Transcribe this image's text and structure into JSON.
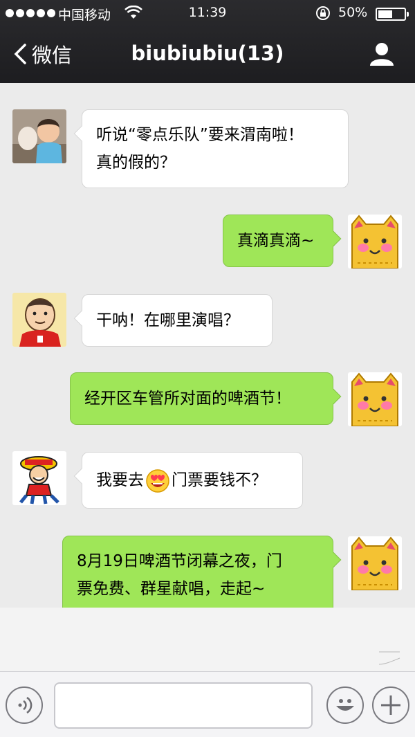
{
  "status_bar": {
    "carrier": "中国移动",
    "time": "11:39",
    "battery": "50%"
  },
  "nav": {
    "back_label": "微信",
    "title": "biubiubiu(13)"
  },
  "messages": [
    {
      "side": "in",
      "lines": [
        "听说“零点乐队”要来渭南啦！",
        "真的假的？"
      ]
    },
    {
      "side": "out",
      "lines": [
        "真滴真滴~"
      ]
    },
    {
      "side": "in",
      "lines": [
        "干呐！在哪里演唱？"
      ]
    },
    {
      "side": "out",
      "lines": [
        "经开区车管所对面的啤酒节！"
      ]
    },
    {
      "side": "in",
      "before_emoji": "我要去",
      "emoji": "heart-eyes-emoji",
      "after_emoji": "门票要钱不？"
    },
    {
      "side": "out",
      "lines": [
        "8月19日啤酒节闭幕之夜，门",
        "票免费、群星献唱，走起~"
      ]
    }
  ],
  "input": {
    "placeholder": ""
  },
  "colors": {
    "nav_bg": "#232326",
    "chat_bg": "#ebebeb",
    "bubble_out": "#9fe658",
    "bubble_in": "#ffffff"
  },
  "icons": [
    "back-chevron-icon",
    "person-icon",
    "voice-icon",
    "smile-icon",
    "plus-icon",
    "wifi-icon",
    "lock-rotation-icon",
    "battery-icon"
  ]
}
